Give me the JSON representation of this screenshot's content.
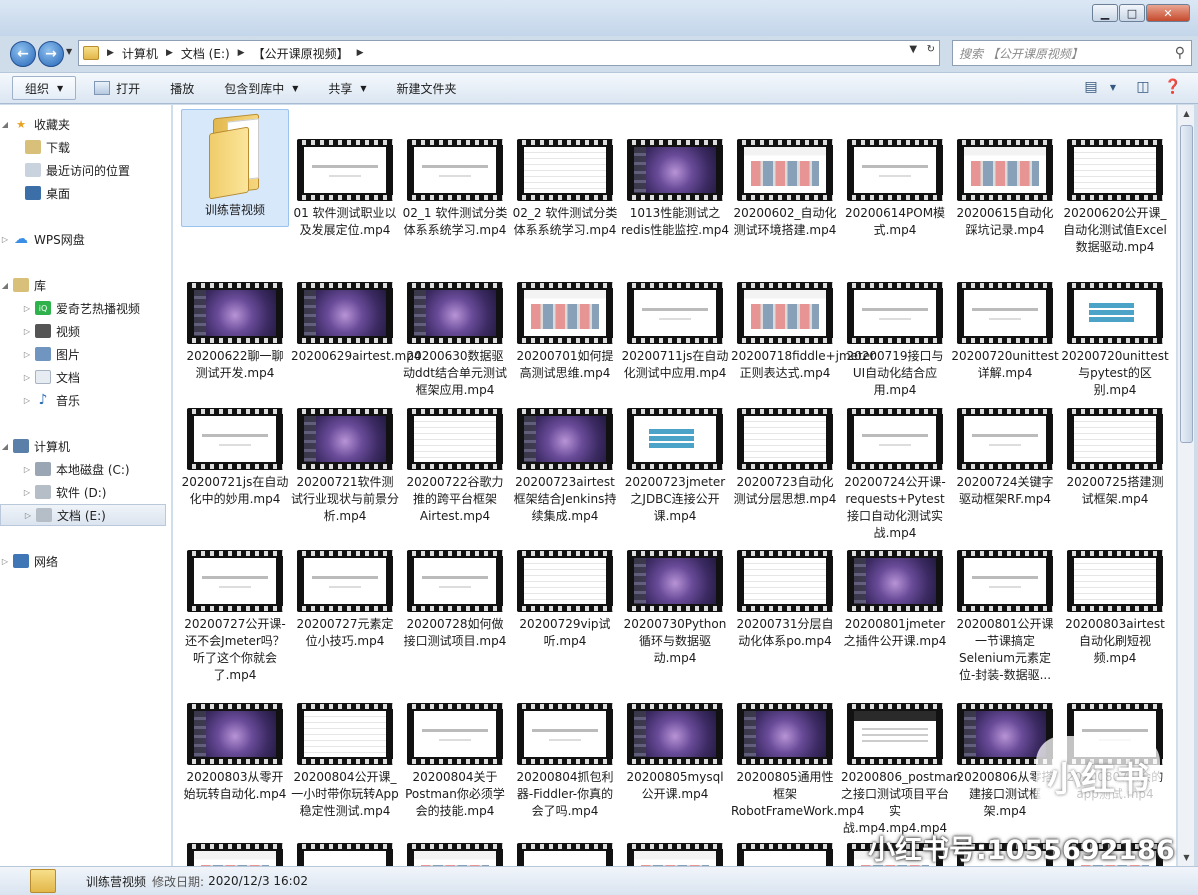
{
  "window": {
    "minimize_icon": "minimize-icon",
    "maximize_icon": "maximize-icon",
    "close_icon": "close-icon"
  },
  "address": {
    "crumbs": [
      "计算机",
      "文档 (E:)",
      "【公开课原视频】"
    ],
    "search_placeholder": "搜索 【公开课原视频】"
  },
  "toolbar": {
    "organize": "组织",
    "open": "打开",
    "play": "播放",
    "include_library": "包含到库中",
    "share": "共享",
    "new_folder": "新建文件夹"
  },
  "sidebar": {
    "favorites": "收藏夹",
    "downloads": "下载",
    "recent": "最近访问的位置",
    "desktop": "桌面",
    "wps": "WPS网盘",
    "libraries": "库",
    "iqiyi": "爱奇艺热播视频",
    "videos": "视频",
    "pictures": "图片",
    "documents": "文档",
    "music": "音乐",
    "computer": "计算机",
    "drive_c": "本地磁盘 (C:)",
    "drive_d": "软件 (D:)",
    "drive_e": "文档 (E:)",
    "network": "网络"
  },
  "files": [
    "训练营视频",
    "01 软件测试职业以及发展定位.mp4",
    "02_1 软件测试分类体系系统学习.mp4",
    "02_2 软件测试分类体系系统学习.mp4",
    "1013性能测试之redis性能监控.mp4",
    "20200602_自动化测试环境搭建.mp4",
    "20200614POM模式.mp4",
    "20200615自动化踩坑记录.mp4",
    "20200620公开课_自动化测试值Excel数据驱动.mp4",
    "20200622聊一聊测试开发.mp4",
    "20200629airtest.mp4",
    "20200630数据驱动ddt结合单元测试框架应用.mp4",
    "20200701如何提高测试思维.mp4",
    "20200711js在自动化测试中应用.mp4",
    "20200718fiddle+jmeter正则表达式.mp4",
    "20200719接口与UI自动化结合应用.mp4",
    "20200720unittest详解.mp4",
    "20200720unittest与pytest的区别.mp4",
    "20200721js在自动化中的妙用.mp4",
    "20200721软件测试行业现状与前景分析.mp4",
    "20200722谷歌力推的跨平台框架Airtest.mp4",
    "20200723airtest框架结合Jenkins持续集成.mp4",
    "20200723jmeter之JDBC连接公开课.mp4",
    "20200723自动化测试分层思想.mp4",
    "20200724公开课-requests+Pytest接口自动化测试实战.mp4",
    "20200724关键字驱动框架RF.mp4",
    "20200725搭建测试框架.mp4",
    "20200727公开课-还不会Jmeter吗？听了这个你就会了.mp4",
    "20200727元素定位小技巧.mp4",
    "20200728如何做接口测试项目.mp4",
    "20200729vip试听.mp4",
    "20200730Python循环与数据驱动.mp4",
    "20200731分层自动化体系po.mp4",
    "20200801jmeter之插件公开课.mp4",
    "20200801公开课一节课搞定Selenium元素定位-封装-数据驱...",
    "20200803airtest自动化刷短视频.mp4",
    "20200803从零开始玩转自动化.mp4",
    "20200804公开课_一小时带你玩转App稳定性测试.mp4",
    "20200804关于Postman你必须学会的技能.mp4",
    "20200804抓包利器-Fiddler-你真的会了吗.mp4",
    "20200805mysql公开课.mp4",
    "20200805通用性框架RobotFrameWork.mp4",
    "20200806_postman之接口测试项目平台实战.mp4.mp4.mp4",
    "20200806从零搭建接口测试框架.mp4",
    "20200807...会的app测试.mp4"
  ],
  "details": {
    "name": "训练营视频",
    "modified_label": "修改日期:",
    "modified_value": "2020/12/3 16:02"
  },
  "watermark": {
    "badge": "小红书",
    "text": "小红书号:1055692186"
  }
}
